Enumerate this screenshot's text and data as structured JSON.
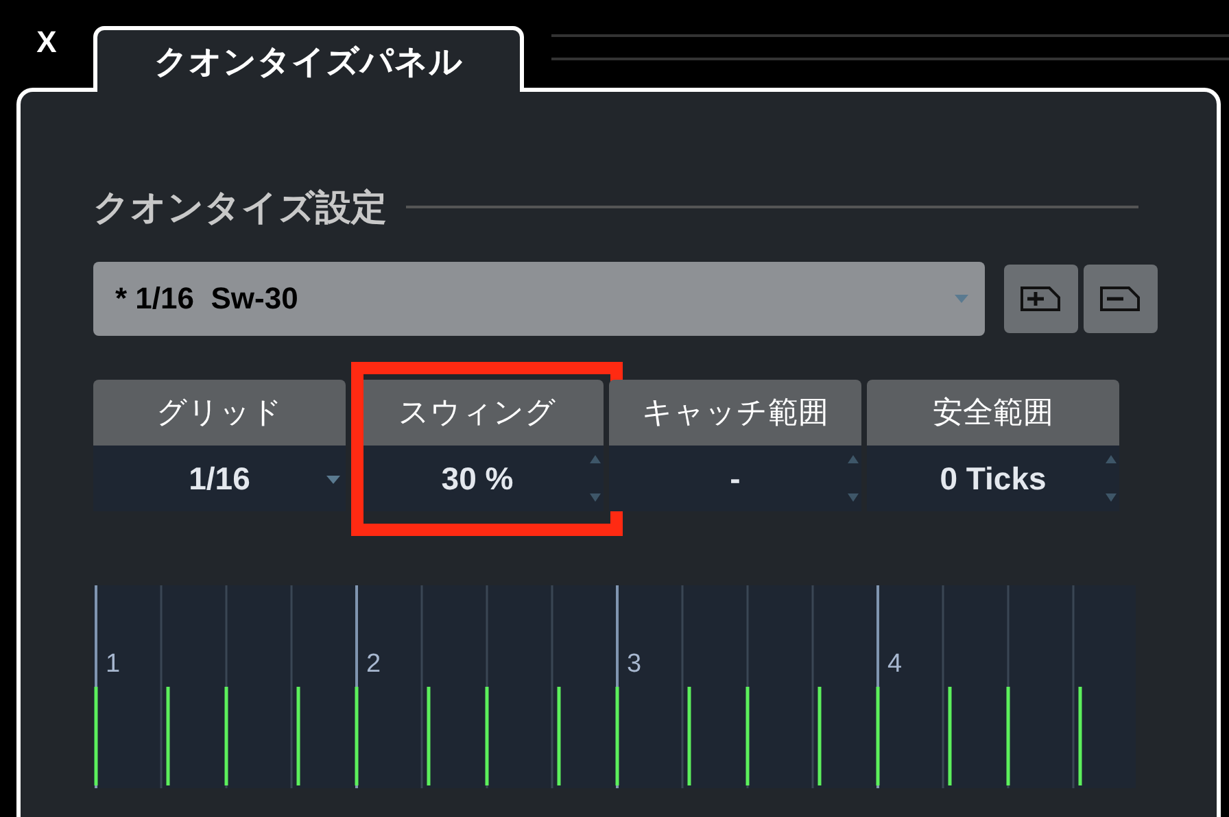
{
  "close_tab": {
    "label": "X"
  },
  "tab": {
    "label": "クオンタイズパネル",
    "selected": true
  },
  "section": {
    "title": "クオンタイズ設定"
  },
  "preset": {
    "value": "* 1/16  Sw-30"
  },
  "columns": [
    {
      "header": "グリッド",
      "value": "1/16",
      "kind": "dropdown",
      "highlighted": false
    },
    {
      "header": "スウィング",
      "value": "30 %",
      "kind": "spinner",
      "highlighted": true
    },
    {
      "header": "キャッチ範囲",
      "value": "-",
      "kind": "spinner",
      "highlighted": false
    },
    {
      "header": "安全範囲",
      "value": "0 Ticks",
      "kind": "spinner",
      "highlighted": false
    }
  ],
  "grid": {
    "beats": [
      "1",
      "2",
      "3",
      "4"
    ]
  }
}
